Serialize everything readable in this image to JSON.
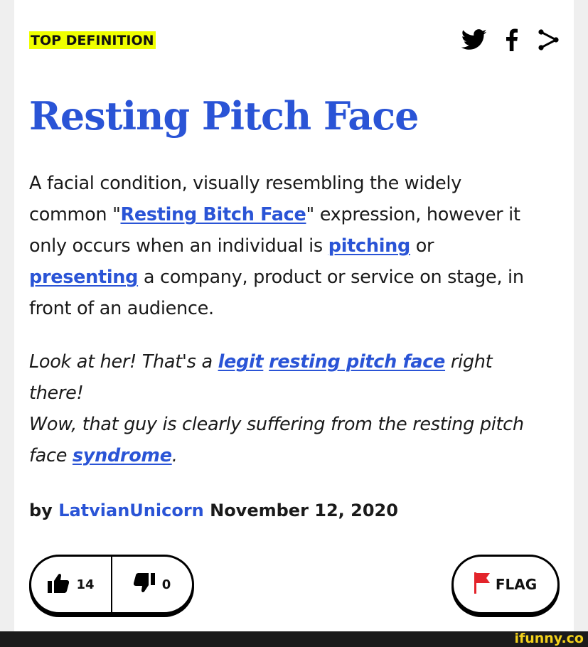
{
  "top_label": "TOP DEFINITION",
  "share": {
    "icons": [
      "twitter-icon",
      "facebook-icon",
      "share-icon"
    ]
  },
  "word": "Resting Pitch Face",
  "meaning": [
    {
      "text": "A facial condition, visually resembling the widely common \""
    },
    {
      "text": "Resting Bitch Face",
      "link": true
    },
    {
      "text": "\" expression, however it only occurs when an individual is "
    },
    {
      "text": "pitching",
      "link": true
    },
    {
      "text": " or "
    },
    {
      "text": "presenting",
      "link": true
    },
    {
      "text": " a company, product or service on stage, in front of an audience."
    }
  ],
  "example": [
    {
      "text": "Look at her! That's a "
    },
    {
      "text": "legit",
      "link": true
    },
    {
      "text": " "
    },
    {
      "text": "resting pitch face",
      "link": true
    },
    {
      "text": " right there!"
    },
    {
      "br": true
    },
    {
      "text": "Wow, that guy is clearly suffering from the resting pitch face "
    },
    {
      "text": "syndrome",
      "link": true
    },
    {
      "text": "."
    }
  ],
  "byline": {
    "prefix": "by",
    "author": "LatvianUnicorn",
    "date": "November 12, 2020"
  },
  "votes": {
    "up": "14",
    "down": "0"
  },
  "flag": {
    "label": "FLAG"
  },
  "watermark": "ifunny.co",
  "colors": {
    "accent": "#2a54d6",
    "highlight": "#efff00",
    "flag": "#e3242b",
    "watermark": "#f3d21b"
  }
}
